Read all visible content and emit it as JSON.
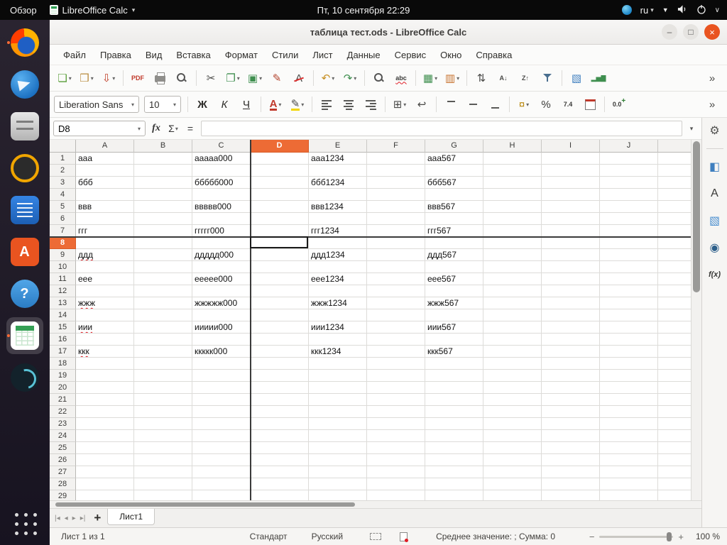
{
  "colors": {
    "accent": "#e95420",
    "selected_header": "#ed6b35",
    "freeze_line": "#3a3a3a"
  },
  "icons": {
    "dropdown": "▾",
    "minimize": "–",
    "maximize": "□",
    "close": "×",
    "network": "▼",
    "chevron": "∨"
  },
  "topbar": {
    "activities": "Обзор",
    "app_menu": "LibreOffice Calc",
    "clock": "Пт, 10 сентября 22:29",
    "lang": "ru"
  },
  "dock": {
    "items": [
      {
        "name": "firefox",
        "cls": "ic-firefox",
        "running": true
      },
      {
        "name": "thunderbird",
        "cls": "ic-thunderbird"
      },
      {
        "name": "files",
        "cls": "ic-files"
      },
      {
        "name": "rhythmbox",
        "cls": "ic-rhythmbox"
      },
      {
        "name": "libreoffice-writer",
        "cls": "ic-writer"
      },
      {
        "name": "ubuntu-software",
        "cls": "ic-software",
        "glyph": "A"
      },
      {
        "name": "help",
        "cls": "ic-help",
        "glyph": "?"
      },
      {
        "name": "libreoffice-calc",
        "cls": "ic-calc",
        "active": true,
        "running": true
      },
      {
        "name": "swirl-app",
        "cls": "ic-swirl"
      },
      {
        "name": "show-applications",
        "cls": "ic-appgrid",
        "bottom": true
      }
    ]
  },
  "window": {
    "title": "таблица тест.ods - LibreOffice Calc"
  },
  "menubar": {
    "items": [
      {
        "key": "file",
        "label": "Файл"
      },
      {
        "key": "edit",
        "label": "Правка"
      },
      {
        "key": "view",
        "label": "Вид"
      },
      {
        "key": "insert",
        "label": "Вставка"
      },
      {
        "key": "format",
        "label": "Формат"
      },
      {
        "key": "styles",
        "label": "Стили"
      },
      {
        "key": "sheet",
        "label": "Лист"
      },
      {
        "key": "data",
        "label": "Данные"
      },
      {
        "key": "tools",
        "label": "Сервис"
      },
      {
        "key": "window",
        "label": "Окно"
      },
      {
        "key": "help",
        "label": "Справка"
      }
    ]
  },
  "toolbar_main": {
    "items": [
      {
        "name": "new-document",
        "glyph": "❏",
        "color": "#5a9e3a",
        "dd": true
      },
      {
        "name": "open-file",
        "glyph": "❒",
        "color": "#b98c3f",
        "dd": true
      },
      {
        "name": "save",
        "glyph": "⇩",
        "color": "#c0402a",
        "dd": true
      },
      {
        "sep": true
      },
      {
        "name": "export-pdf",
        "glyph": "PDF",
        "txt": true,
        "color": "#c0392b"
      },
      {
        "name": "print",
        "cls": "ic-print"
      },
      {
        "name": "print-preview",
        "cls": "ic-zoom"
      },
      {
        "sep": true
      },
      {
        "name": "cut",
        "glyph": "✂",
        "color": "#4a4a48"
      },
      {
        "name": "copy",
        "glyph": "❐",
        "color": "#3f8f4f",
        "dd": true
      },
      {
        "name": "paste",
        "glyph": "▣",
        "color": "#3f8f4f",
        "dd": true
      },
      {
        "name": "clone-formatting",
        "glyph": "✎",
        "color": "#b3452f"
      },
      {
        "name": "clear-formatting",
        "glyph": "A",
        "cls": "strike",
        "color": "#4a4a48"
      },
      {
        "sep": true
      },
      {
        "name": "undo",
        "glyph": "↶",
        "color": "#c79023",
        "dd": true
      },
      {
        "name": "redo",
        "glyph": "↷",
        "color": "#3f8f4f",
        "dd": true
      },
      {
        "sep": true
      },
      {
        "name": "find-and-replace",
        "cls": "ic-zoom"
      },
      {
        "name": "spelling",
        "glyph": "abc",
        "txt": true,
        "cls": "spell",
        "color": "#3a3a38"
      },
      {
        "sep": true
      },
      {
        "name": "insert-row",
        "glyph": "▦",
        "color": "#3f8f4f",
        "dd": true
      },
      {
        "name": "insert-column",
        "glyph": "▥",
        "color": "#c7722e",
        "dd": true
      },
      {
        "sep": true
      },
      {
        "name": "sort",
        "glyph": "⇅",
        "color": "#4a4a48"
      },
      {
        "name": "sort-ascending",
        "glyph": "A↓",
        "txt": true,
        "color": "#4a4a48"
      },
      {
        "name": "sort-descending",
        "glyph": "Z↑",
        "txt": true,
        "color": "#4a4a48"
      },
      {
        "name": "autofilter",
        "cls": "ic-funnel"
      },
      {
        "sep": true
      },
      {
        "name": "insert-image",
        "glyph": "▧",
        "color": "#3f7fbf"
      },
      {
        "name": "insert-chart",
        "glyph": "▂▅▇",
        "txt": true,
        "color": "#3f8f4f"
      },
      {
        "name": "toolbar-overflow",
        "glyph": "»",
        "color": "#4a4a48",
        "push": true
      }
    ]
  },
  "toolbar_format": {
    "font_name": "Liberation Sans",
    "font_size": "10",
    "items": [
      {
        "name": "bold",
        "glyph": "Ж",
        "cls": "g-b",
        "color": "#2f2e2b"
      },
      {
        "name": "italic",
        "glyph": "К",
        "cls": "g-i",
        "color": "#2f2e2b"
      },
      {
        "name": "underline",
        "glyph": "Ч",
        "cls": "g-u",
        "color": "#2f2e2b"
      },
      {
        "sep": true
      },
      {
        "name": "font-color",
        "glyph": "А",
        "cls": "fontcolor",
        "dd": true
      },
      {
        "name": "highlighting-color",
        "glyph": "✎",
        "cls": "hl",
        "color": "#4a4a48",
        "dd": true
      },
      {
        "sep": true
      },
      {
        "name": "align-left",
        "cls": "al-l"
      },
      {
        "name": "align-center",
        "cls": "al-c"
      },
      {
        "name": "align-right",
        "cls": "al-r"
      },
      {
        "sep": true
      },
      {
        "name": "merge-cells",
        "glyph": "⊞",
        "color": "#4a4a48",
        "dd": true
      },
      {
        "name": "wrap-text",
        "glyph": "↩",
        "color": "#4a4a48"
      },
      {
        "sep": true
      },
      {
        "name": "align-top",
        "cls": "va-t"
      },
      {
        "name": "align-center-vertically",
        "cls": "va-m"
      },
      {
        "name": "align-bottom",
        "cls": "va-b"
      },
      {
        "sep": true
      },
      {
        "name": "format-as-currency",
        "glyph": "¤",
        "color": "#b8860b",
        "dd": true
      },
      {
        "name": "format-as-percent",
        "glyph": "%",
        "color": "#3a3a38"
      },
      {
        "name": "format-as-number",
        "glyph": "7.4",
        "txt": true,
        "color": "#3a3a38"
      },
      {
        "name": "format-as-date",
        "cls": "ic-cal"
      },
      {
        "sep": true
      },
      {
        "name": "add-decimal-place",
        "glyph": "0.0",
        "txt": true,
        "color": "#3a3a38",
        "badge": "+"
      },
      {
        "name": "toolbar-overflow",
        "glyph": "»",
        "color": "#4a4a48",
        "push": true
      }
    ]
  },
  "formula_bar": {
    "name_box": "D8",
    "buttons": [
      {
        "name": "function-wizard",
        "glyph": "fx",
        "cls": "fx"
      },
      {
        "name": "select-sum",
        "glyph": "Σ",
        "dd": true
      },
      {
        "name": "formula",
        "glyph": "="
      }
    ],
    "input_value": ""
  },
  "sheet": {
    "columns": [
      "A",
      "B",
      "C",
      "D",
      "E",
      "F",
      "G",
      "H",
      "I",
      "J"
    ],
    "visible_rows": 30,
    "selected": {
      "cell": "D8",
      "col": "D",
      "row": 8
    },
    "freeze": {
      "col": "D",
      "row": 8
    },
    "cells": {
      "A1": "ааа",
      "C1": "ааааа000",
      "E1": "ааа1234",
      "G1": "ааа567",
      "A3": "ббб",
      "C3": "ббббб000",
      "E3": "ббб1234",
      "G3": "ббб567",
      "A5": "ввв",
      "C5": "ввввв000",
      "E5": "ввв1234",
      "G5": "ввв567",
      "A7": "ггг",
      "C7": "ггггг000",
      "E7": "ггг1234",
      "G7": "ггг567",
      "A9": "ддд",
      "C9": "ддддд000",
      "E9": "ддд1234",
      "G9": "ддд567",
      "A11": "еее",
      "C11": "еееее000",
      "E11": "еее1234",
      "G11": "еее567",
      "A13": "жжж",
      "C13": "жжжжж000",
      "E13": "жжж1234",
      "G13": "жжж567",
      "A15": "иии",
      "C15": "иииии000",
      "E15": "иии1234",
      "G15": "иии567",
      "A17": "ккк",
      "C17": "ккккк000",
      "E17": "ккк1234",
      "G17": "ккк567"
    },
    "misspelled": [
      "A9",
      "A13",
      "A15",
      "A17"
    ]
  },
  "tabbar": {
    "nav": [
      {
        "name": "first-sheet",
        "glyph": "|◂"
      },
      {
        "name": "previous-sheet",
        "glyph": "◂"
      },
      {
        "name": "next-sheet",
        "glyph": "▸"
      },
      {
        "name": "last-sheet",
        "glyph": "▸|"
      }
    ],
    "add_sheet": "+",
    "sheet_tab": "Лист1"
  },
  "statusbar": {
    "sheet_info": "Лист 1 из 1",
    "page_style": "Стандарт",
    "language": "Русский",
    "summary": "Среднее значение: ; Сумма: 0",
    "zoom_out": "−",
    "zoom_in": "+",
    "zoom": "100 %"
  },
  "sidebar": {
    "items": [
      {
        "name": "sidebar-settings",
        "glyph": "⚙",
        "color": "#555553"
      },
      {
        "sep": true
      },
      {
        "name": "properties",
        "glyph": "◧",
        "color": "#3f7fbf"
      },
      {
        "name": "styles",
        "glyph": "A",
        "color": "#3a3a38"
      },
      {
        "name": "gallery",
        "glyph": "▧",
        "color": "#4a8fd0"
      },
      {
        "name": "navigator",
        "glyph": "◉",
        "color": "#2d5f8a"
      },
      {
        "name": "functions",
        "glyph": "f(x)",
        "cls": "sb-fx",
        "color": "#3a3a38"
      }
    ]
  }
}
